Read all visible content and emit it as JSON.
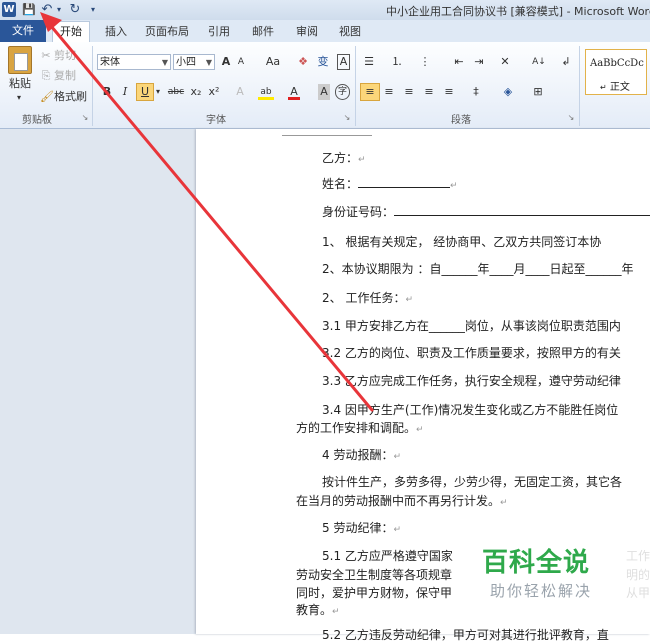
{
  "window": {
    "title": "中小企业用工合同协议书 [兼容模式] - Microsoft Word (读"
  },
  "qat": {
    "logo": "W",
    "save": "💾",
    "undo": "↶",
    "redo": "↻",
    "more": "▾"
  },
  "tabs": {
    "file": "文件",
    "home": "开始",
    "insert": "插入",
    "layout": "页面布局",
    "references": "引用",
    "mailings": "邮件",
    "review": "审阅",
    "view": "视图"
  },
  "clipboard": {
    "paste": "粘贴",
    "cut": "剪切",
    "copy": "复制",
    "format_painter": "格式刷",
    "group": "剪贴板"
  },
  "font": {
    "name": "宋体",
    "size": "小四",
    "grow": "A",
    "shrink": "A",
    "case": "Aa",
    "clear": "❖",
    "phonetic": "变",
    "border": "A",
    "bold": "B",
    "italic": "I",
    "underline": "U",
    "strike": "abc",
    "subscript": "x₂",
    "superscript": "x²",
    "effects": "A",
    "highlight": "ab",
    "color": "A",
    "shading": "A",
    "enclose": "字",
    "group": "字体"
  },
  "paragraph": {
    "group": "段落",
    "bullets": "☰",
    "numbering": "⒈",
    "multilevel": "⋮",
    "dec_indent": "⇤",
    "inc_indent": "⇥",
    "chinese_layout": "✕",
    "sort": "A↓",
    "show_marks": "↲",
    "align_left": "≡",
    "center": "≡",
    "align_right": "≡",
    "justify": "≡",
    "distributed": "≡",
    "line_spacing": "‡",
    "shading": "◈",
    "borders": "⊞"
  },
  "styles": {
    "preview": "AaBbCcDc",
    "normal": "正文"
  },
  "document": {
    "lines": [
      "乙方：",
      "姓名：",
      "身份证号码：",
      "1、      根据有关规定，  经协商甲、乙双方共同签订本协",
      "2、本协议期限为 ：自______年____月____日起至______年",
      "2、      工作任务：",
      "3.1 甲方安排乙方在______岗位，从事该岗位职责范围内",
      "3.2 乙方的岗位、职责及工作质量要求，按照甲方的有关",
      "3.3 乙方应完成工作任务，执行安全规程，遵守劳动纪律",
      "3.4 因甲方生产(工作)情况发生变化或乙方不能胜任岗位",
      "方的工作安排和调配。",
      "4 劳动报酬：",
      "按计件生产，多劳多得，少劳少得，无固定工资，其它各",
      "在当月的劳动报酬中而不再另行计发。",
      "5 劳动纪律：",
      "5.1 乙方应严格遵守国家",
      "劳动安全卫生制度等各项规章",
      "同时，爱护甲方财物，保守甲",
      "教育。",
      "5.2 乙方违反劳动纪律，甲方可对其进行批评教育，直"
    ],
    "right_fragments": [
      "工作",
      "明的",
      "从甲"
    ]
  },
  "watermark": {
    "title": "百科全说",
    "subtitle": "助你轻松解决"
  },
  "colors": {
    "file_tab": "#2a5699",
    "watermark": "#2fa94b",
    "arrow": "#e8353a"
  }
}
